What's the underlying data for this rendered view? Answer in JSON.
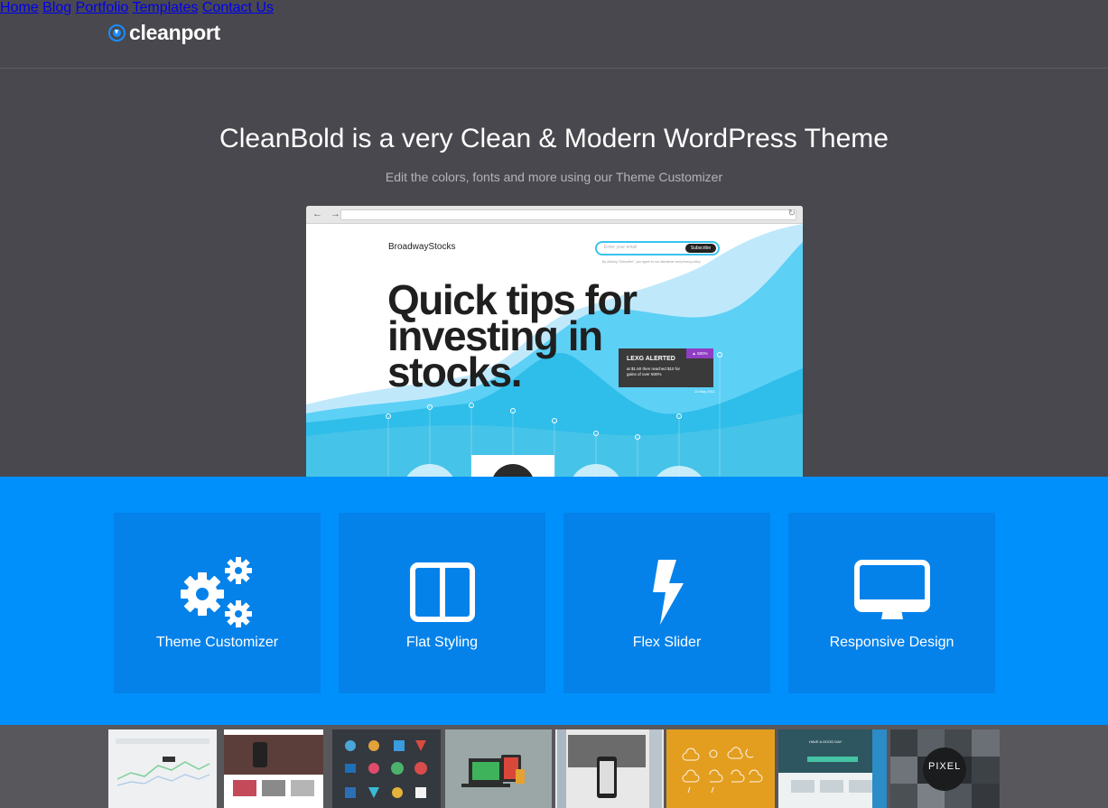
{
  "brand": {
    "name": "cleanport",
    "accent": "#1b8dff"
  },
  "nav": {
    "items": [
      {
        "label": "Home"
      },
      {
        "label": "Blog"
      },
      {
        "label": "Portfolio"
      },
      {
        "label": "Templates"
      },
      {
        "label": "Contact Us"
      }
    ]
  },
  "hero": {
    "title": "CleanBold is a very Clean & Modern WordPress Theme",
    "subtitle": "Edit the colors, fonts and more using our Theme Customizer"
  },
  "preview": {
    "brand": "BroadwayStocks",
    "email_placeholder": "Enter your email",
    "subscribe_label": "Subscribe",
    "fine_print": "By clicking \"Subscribe\", you agree to our disclaimer and privacy policy.",
    "headline": "Quick tips for investing in stocks.",
    "alert": {
      "badge": "▲ 500%",
      "title": "LEXG ALERTED",
      "text": "at $1.60 then reached $10 for gains of over 500%",
      "date": "10 May 2011"
    }
  },
  "features": {
    "bg_color": "#0090fb",
    "tile_color": "#0482ea",
    "items": [
      {
        "label": "Theme Customizer",
        "icon": "gears-icon"
      },
      {
        "label": "Flat Styling",
        "icon": "columns-icon"
      },
      {
        "label": "Flex Slider",
        "icon": "lightning-icon"
      },
      {
        "label": "Responsive Design",
        "icon": "monitor-icon"
      }
    ]
  },
  "thumbnails": {
    "pixel_label": "PIXEL",
    "good_day_label": "HAVE A GOOD DAY"
  }
}
